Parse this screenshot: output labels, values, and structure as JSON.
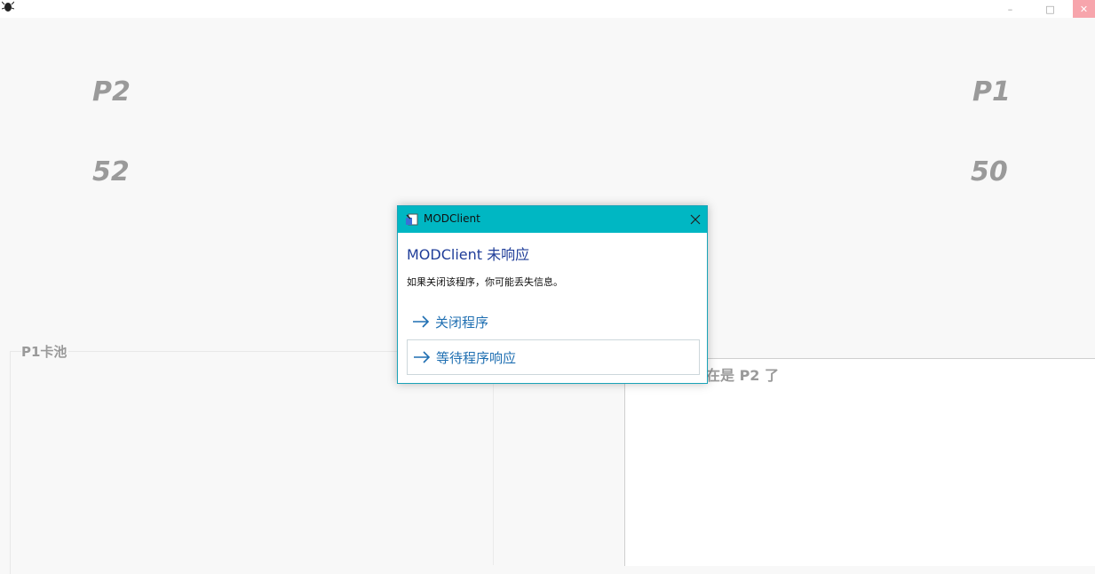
{
  "window": {
    "icon": "beetle-app-icon",
    "controls": {
      "minimize": "–",
      "maximize": "□",
      "close": "✕"
    }
  },
  "game": {
    "p2_name": "P2",
    "p2_score": "52",
    "p1_name": "P1",
    "p1_score": "50",
    "pool_title": "P1卡池",
    "log_text": "在是 P2 了"
  },
  "dialog": {
    "title": "MODClient",
    "heading": "MODClient 未响应",
    "message": "如果关闭该程序，你可能丢失信息。",
    "option_close": "关闭程序",
    "option_wait": "等待程序响应",
    "colors": {
      "titlebar": "#00b7c3",
      "heading": "#1f3d99",
      "link": "#1f6fb2"
    }
  }
}
